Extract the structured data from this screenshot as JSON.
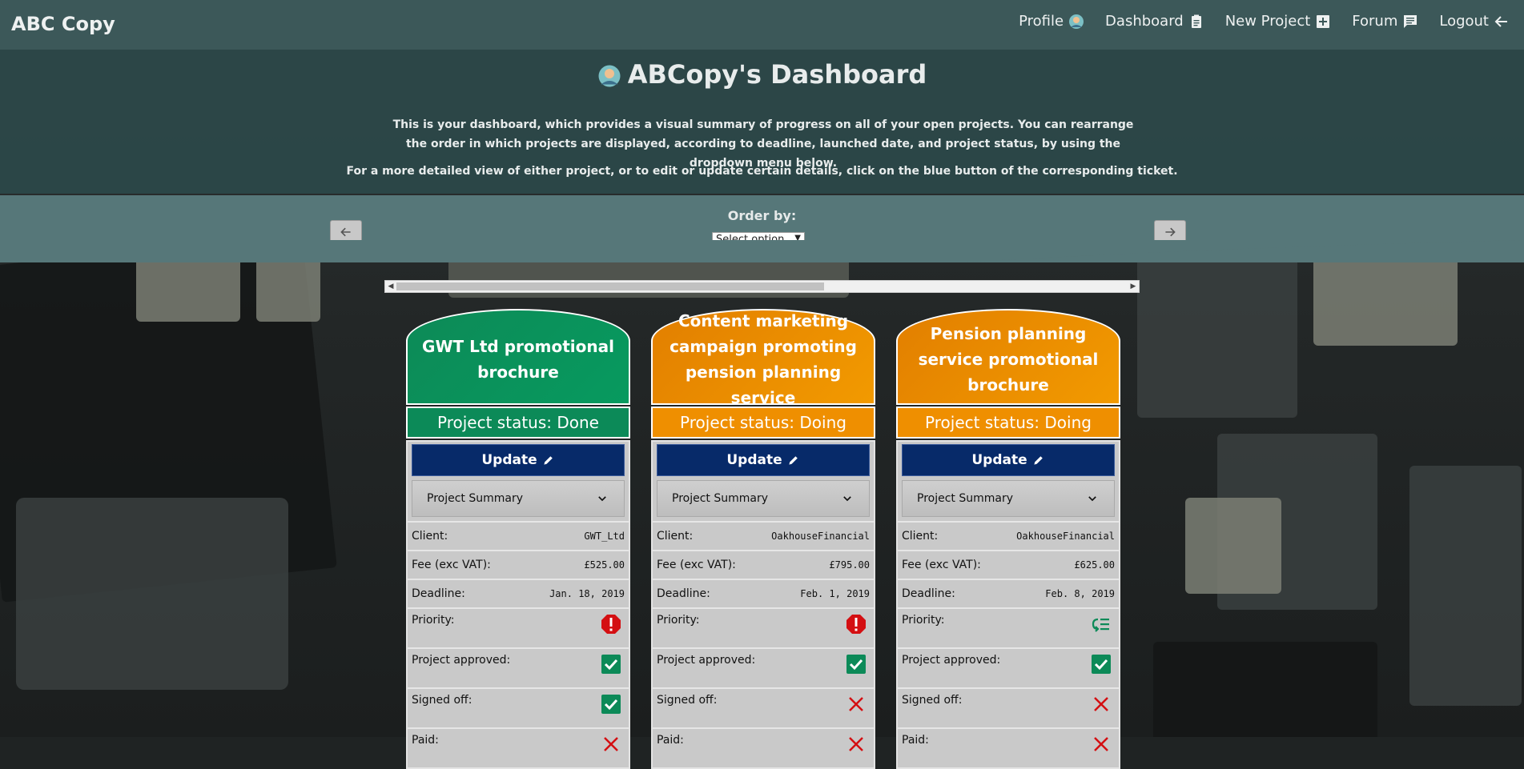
{
  "navbar": {
    "brand": "ABC Copy",
    "items": [
      {
        "label": "Profile",
        "icon": "avatar-icon"
      },
      {
        "label": "Dashboard",
        "icon": "clipboard-icon"
      },
      {
        "label": "New Project",
        "icon": "plus-box-icon"
      },
      {
        "label": "Forum",
        "icon": "chat-icon"
      },
      {
        "label": "Logout",
        "icon": "arrow-left-icon"
      }
    ]
  },
  "header": {
    "title": "ABCopy's Dashboard",
    "intro": "This is your dashboard, which provides a visual summary of progress on all of your open projects. You can rearrange the order in which projects are displayed, according to deadline, launched date, and project status, by using the dropdown menu below.",
    "intro2": "For a more detailed view of either project, or to edit or update certain details, click on the blue button of the corresponding ticket."
  },
  "order": {
    "label": "Order by:",
    "selected": "Select option..."
  },
  "colors": {
    "navbar": "#3c5859",
    "done": "#0c8a58",
    "doing": "#ef8f00",
    "update": "#072a69"
  },
  "labels": {
    "update": "Update",
    "summary": "Project Summary",
    "client": "Client:",
    "fee": "Fee (exc VAT):",
    "deadline": "Deadline:",
    "priority": "Priority:",
    "approved": "Project approved:",
    "signed": "Signed off:",
    "paid": "Paid:"
  },
  "projects": [
    {
      "title": "GWT Ltd promotional brochure",
      "status": "Project status: Done",
      "client": "GWT_Ltd",
      "fee": "£525.00",
      "deadline": "Jan. 18, 2019",
      "priority": "high",
      "approved": true,
      "signed": true,
      "paid": false
    },
    {
      "title": "Content marketing campaign promoting pension planning service",
      "status": "Project status: Doing",
      "client": "OakhouseFinancial",
      "fee": "£795.00",
      "deadline": "Feb. 1, 2019",
      "priority": "high",
      "approved": true,
      "signed": false,
      "paid": false
    },
    {
      "title": "Pension planning service promotional brochure",
      "status": "Project status: Doing",
      "client": "OakhouseFinancial",
      "fee": "£625.00",
      "deadline": "Feb. 8, 2019",
      "priority": "low",
      "approved": true,
      "signed": false,
      "paid": false
    }
  ]
}
